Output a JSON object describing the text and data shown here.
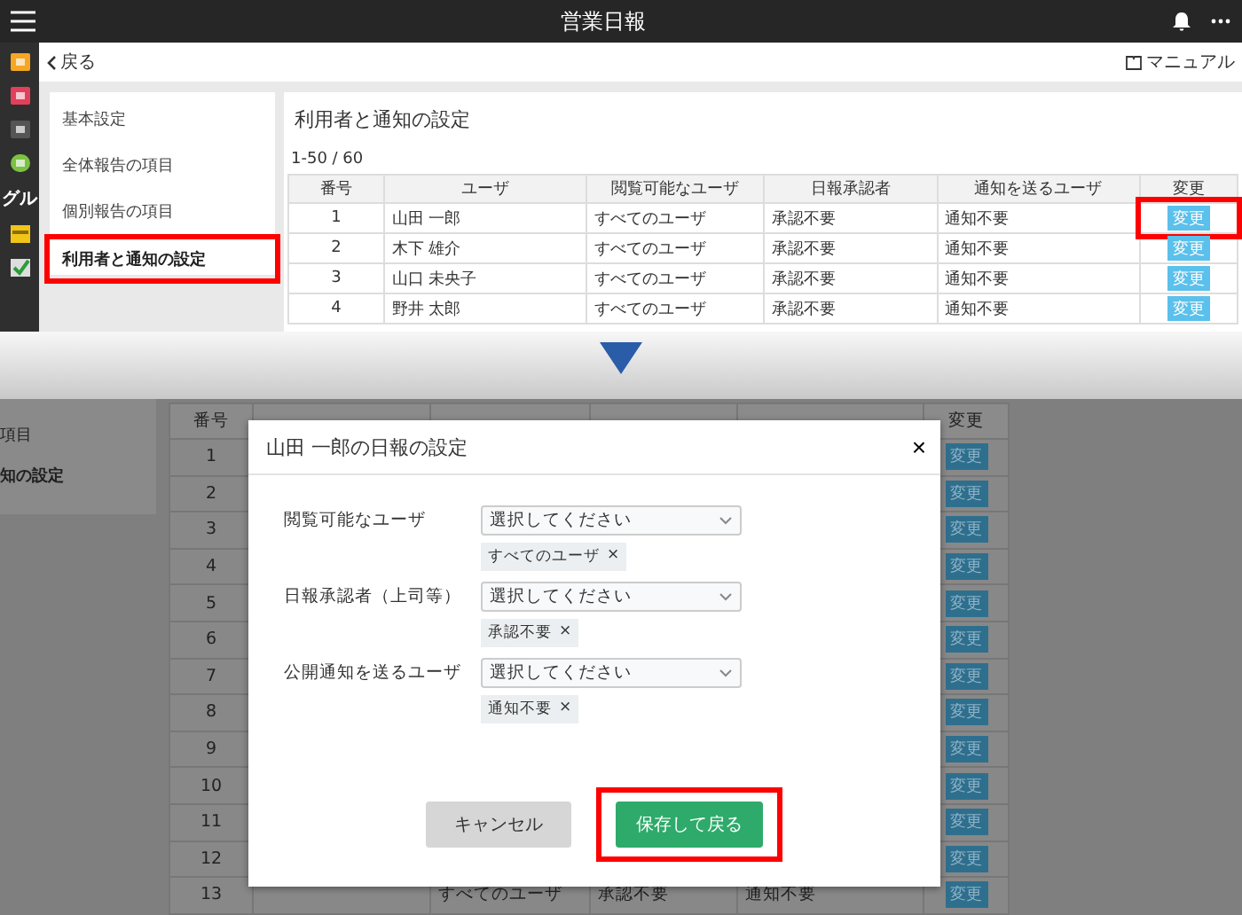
{
  "app_bar": {
    "title": "営業日報"
  },
  "side_rail": {
    "label": "グル"
  },
  "back_bar": {
    "back": "戻る",
    "manual": "マニュアル"
  },
  "settings_menu": [
    {
      "label": "基本設定",
      "selected": false,
      "highlight": false
    },
    {
      "label": "全体報告の項目",
      "selected": false,
      "highlight": false
    },
    {
      "label": "個別報告の項目",
      "selected": false,
      "highlight": false
    },
    {
      "label": "利用者と通知の設定",
      "selected": true,
      "highlight": true
    }
  ],
  "panel": {
    "title": "利用者と通知の設定",
    "range": "1-50 / 60"
  },
  "table": {
    "columns": [
      "番号",
      "ユーザ",
      "閲覧可能なユーザ",
      "日報承認者",
      "通知を送るユーザ",
      "変更"
    ],
    "rows": [
      {
        "no": "1",
        "user": "山田 一郎",
        "viewers": "すべてのユーザ",
        "approver": "承認不要",
        "notify": "通知不要",
        "button": "変更",
        "highlight": true
      },
      {
        "no": "2",
        "user": "木下 雄介",
        "viewers": "すべてのユーザ",
        "approver": "承認不要",
        "notify": "通知不要",
        "button": "変更",
        "highlight": false
      },
      {
        "no": "3",
        "user": "山口 未央子",
        "viewers": "すべてのユーザ",
        "approver": "承認不要",
        "notify": "通知不要",
        "button": "変更",
        "highlight": false
      },
      {
        "no": "4",
        "user": "野井 太郎",
        "viewers": "すべてのユーザ",
        "approver": "承認不要",
        "notify": "通知不要",
        "button": "変更",
        "highlight": false
      }
    ]
  },
  "background": {
    "menu": [
      "項目",
      "知の設定"
    ],
    "columns": [
      "番号",
      "変更"
    ],
    "rows": [
      {
        "no": "1",
        "button": "変更"
      },
      {
        "no": "2",
        "button": "変更"
      },
      {
        "no": "3",
        "button": "変更"
      },
      {
        "no": "4",
        "button": "変更"
      },
      {
        "no": "5",
        "button": "変更"
      },
      {
        "no": "6",
        "button": "変更"
      },
      {
        "no": "7",
        "button": "変更"
      },
      {
        "no": "8",
        "button": "変更"
      },
      {
        "no": "9",
        "button": "変更"
      },
      {
        "no": "10",
        "button": "変更"
      },
      {
        "no": "11",
        "button": "変更"
      },
      {
        "no": "12",
        "button": "変更"
      },
      {
        "no": "13",
        "viewers": "すべてのユーザ",
        "approver": "承認不要",
        "notify": "通知不要",
        "button": "変更"
      }
    ]
  },
  "dialog": {
    "title": "山田 一郎の日報の設定",
    "close": "×",
    "fields": [
      {
        "label": "閲覧可能なユーザ",
        "placeholder": "選択してください",
        "chip": "すべてのユーザ",
        "remove": "×"
      },
      {
        "label": "日報承認者（上司等）",
        "placeholder": "選択してください",
        "chip": "承認不要",
        "remove": "×"
      },
      {
        "label": "公開通知を送るユーザ",
        "placeholder": "選択してください",
        "chip": "通知不要",
        "remove": "×"
      }
    ],
    "buttons": [
      {
        "kind": "cancel",
        "label": "キャンセル",
        "highlight": false
      },
      {
        "kind": "primary",
        "label": "保存して戻る",
        "highlight": true
      }
    ]
  }
}
